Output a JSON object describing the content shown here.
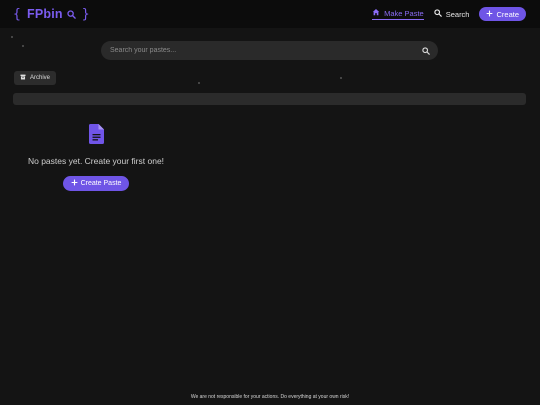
{
  "header": {
    "logo_open": "{",
    "logo_name": "FPbin",
    "logo_close": "}",
    "nav": {
      "make_paste": "Make Paste",
      "search": "Search",
      "create": "Create"
    }
  },
  "search": {
    "placeholder": "Search your pastes..."
  },
  "archive_label": "Archive",
  "empty_state": {
    "message": "No pastes yet. Create your first one!",
    "button_label": "Create Paste"
  },
  "footer": "We are not responsible for your actions. Do everything at your own risk!",
  "colors": {
    "accent": "#6f55e6",
    "accent_text": "#8b6cf6",
    "background": "#141414"
  },
  "icons": {
    "logo": "search-icon",
    "make_paste": "home-icon",
    "nav_search": "search-icon",
    "create": "plus-icon",
    "search_field": "search-icon",
    "archive": "archive-box-icon",
    "empty": "document-icon"
  }
}
